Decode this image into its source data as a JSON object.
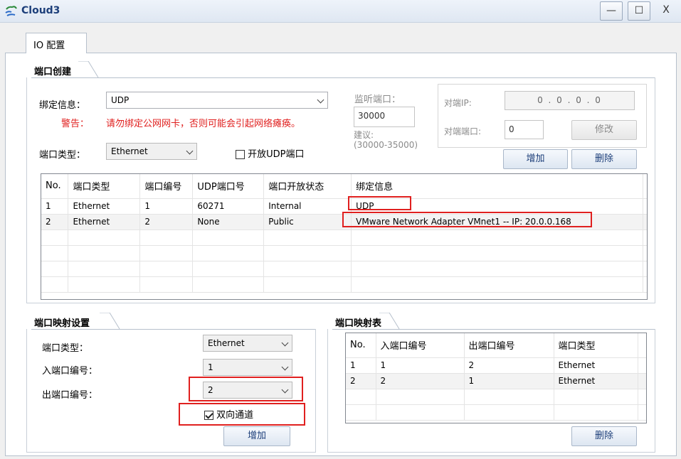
{
  "window": {
    "title": "Cloud3",
    "minimize_label": "—",
    "maximize_label": "☐",
    "close_label": "X"
  },
  "tabs": [
    {
      "label": "IO 配置"
    }
  ],
  "port_create": {
    "section_title": "端口创建",
    "binding_label": "绑定信息：",
    "binding_value": "UDP",
    "warning_label": "警告：",
    "warning_text": "请勿绑定公网网卡，否则可能会引起网络瘫痪。",
    "port_type_label": "端口类型：",
    "port_type_value": "Ethernet",
    "open_udp_label": "开放UDP端口",
    "open_udp_checked": false,
    "listen_port_label": "监听端口：",
    "listen_port_value": "30000",
    "suggest_label": "建议:",
    "suggest_range": "(30000-35000)",
    "peer_ip_label": "对端IP:",
    "peer_ip_value": "0 . 0 . 0 . 0",
    "peer_port_label": "对端端口:",
    "peer_port_value": "0",
    "modify_button": "修改",
    "add_button": "增加",
    "delete_button": "删除",
    "table": {
      "columns": [
        "No.",
        "端口类型",
        "端口编号",
        "UDP端口号",
        "端口开放状态",
        "绑定信息"
      ],
      "rows": [
        [
          "1",
          "Ethernet",
          "1",
          "60271",
          "Internal",
          "UDP"
        ],
        [
          "2",
          "Ethernet",
          "2",
          "None",
          "Public",
          "VMware Network Adapter VMnet1 -- IP: 20.0.0.168"
        ]
      ]
    }
  },
  "port_mapping": {
    "section_title": "端口映射设置",
    "port_type_label": "端口类型：",
    "port_type_value": "Ethernet",
    "in_port_label": "入端口编号：",
    "in_port_value": "1",
    "out_port_label": "出端口编号：",
    "out_port_value": "2",
    "bidirectional_label": "双向通道",
    "bidirectional_checked": true,
    "add_button": "增加"
  },
  "mapping_table": {
    "section_title": "端口映射表",
    "columns": [
      "No.",
      "入端口编号",
      "出端口编号",
      "端口类型"
    ],
    "rows": [
      [
        "1",
        "1",
        "2",
        "Ethernet"
      ],
      [
        "2",
        "2",
        "1",
        "Ethernet"
      ]
    ],
    "delete_button": "删除"
  },
  "colors": {
    "accent": "#1d3f7a",
    "warning": "#e0201f",
    "highlight_box": "#e0201f"
  }
}
